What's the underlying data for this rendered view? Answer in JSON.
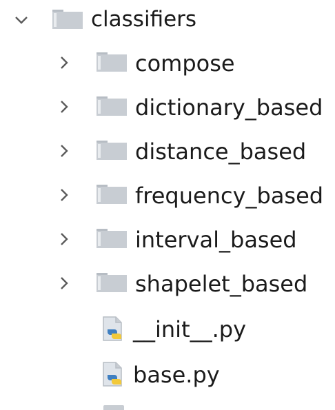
{
  "project_tree": {
    "root": {
      "label": "classifiers",
      "expanded": true,
      "chevron_icon": "chevron-down-icon",
      "icon": "folder-icon"
    },
    "children": [
      {
        "label": "compose",
        "type": "folder",
        "chevron_icon": "chevron-right-icon",
        "icon": "folder-icon"
      },
      {
        "label": "dictionary_based",
        "type": "folder",
        "chevron_icon": "chevron-right-icon",
        "icon": "folder-icon"
      },
      {
        "label": "distance_based",
        "type": "folder",
        "chevron_icon": "chevron-right-icon",
        "icon": "folder-icon"
      },
      {
        "label": "frequency_based",
        "type": "folder",
        "chevron_icon": "chevron-right-icon",
        "icon": "folder-icon"
      },
      {
        "label": "interval_based",
        "type": "folder",
        "chevron_icon": "chevron-right-icon",
        "icon": "folder-icon"
      },
      {
        "label": "shapelet_based",
        "type": "folder",
        "chevron_icon": "chevron-right-icon",
        "icon": "folder-icon"
      },
      {
        "label": "__init__.py",
        "type": "file",
        "icon": "python-file-icon"
      },
      {
        "label": "base.py",
        "type": "file",
        "icon": "python-file-icon"
      }
    ]
  },
  "colors": {
    "folder_fill": "#c8cdd3",
    "folder_tab": "#b7bdc4",
    "chevron": "#5a5a5a",
    "text": "#1b1b1b",
    "python_blue": "#3f7fc1",
    "python_yellow": "#f2c93a"
  }
}
